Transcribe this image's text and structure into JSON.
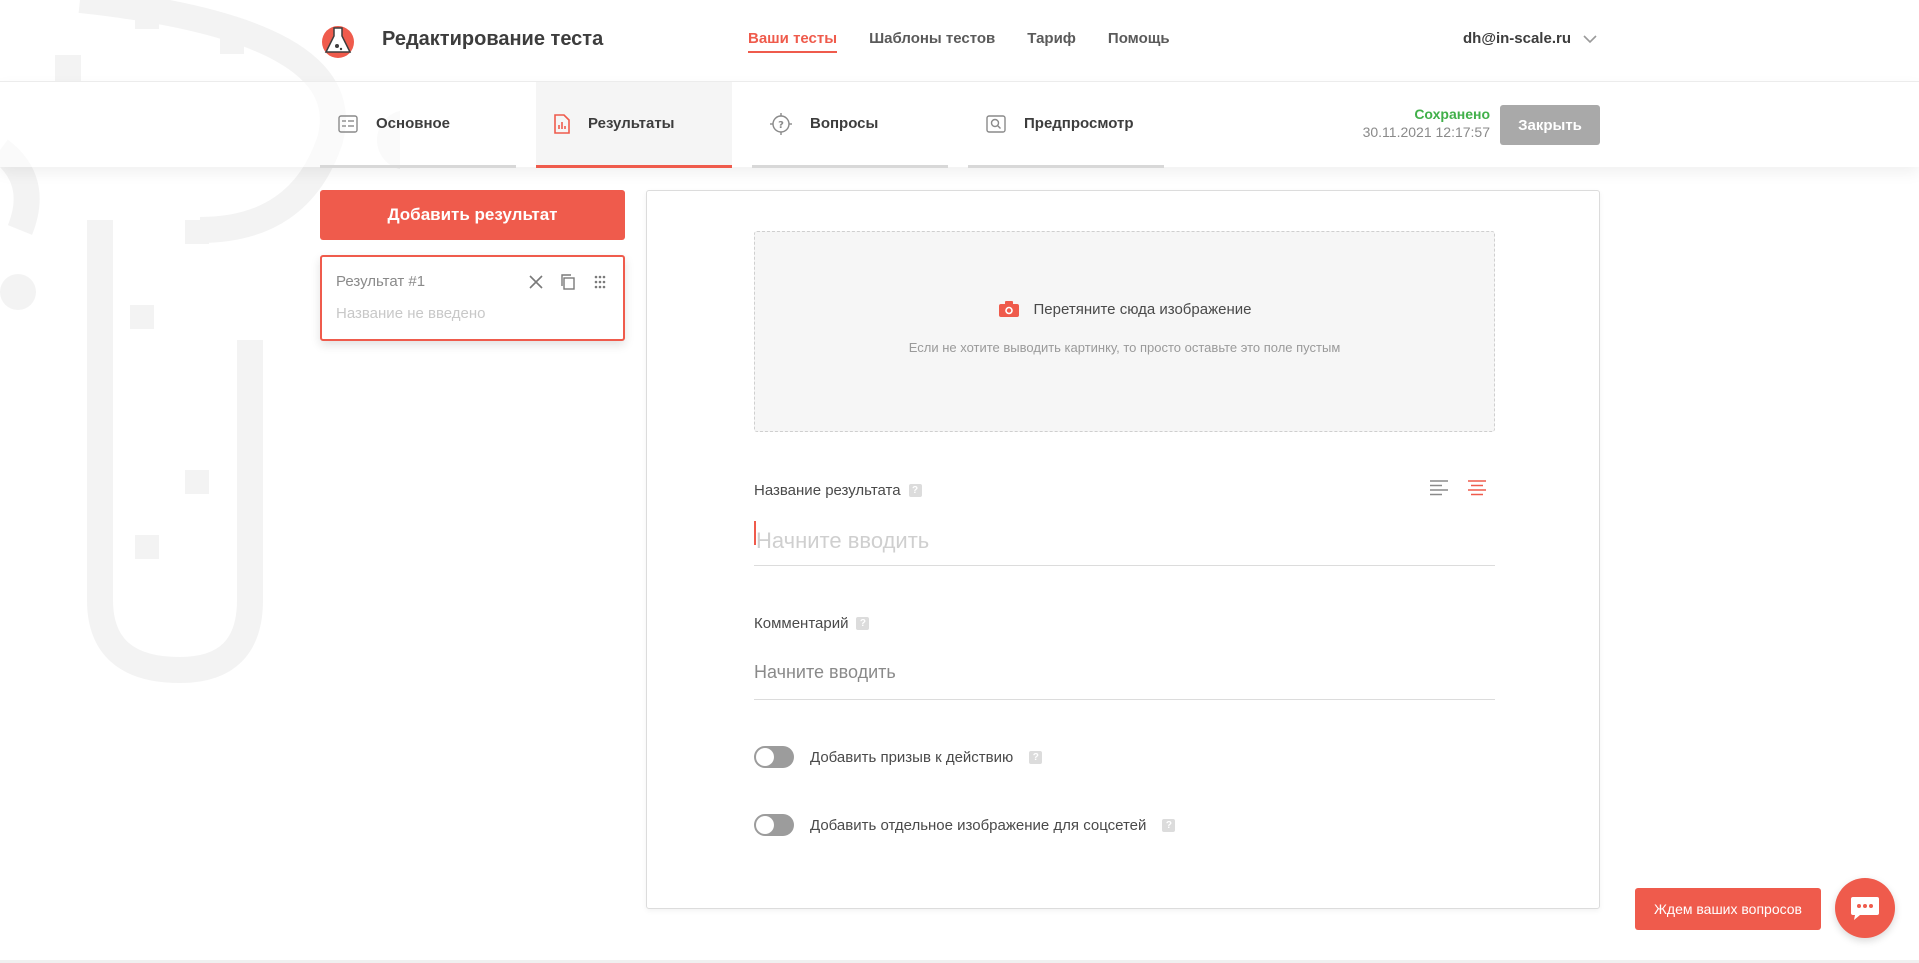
{
  "header": {
    "title": "Редактирование теста",
    "nav": [
      {
        "label": "Ваши тесты",
        "active": true
      },
      {
        "label": "Шаблоны тестов",
        "active": false
      },
      {
        "label": "Тариф",
        "active": false
      },
      {
        "label": "Помощь",
        "active": false
      }
    ],
    "user_email": "dh@in-scale.ru"
  },
  "tabs": [
    {
      "label": "Основное",
      "icon": "form-icon",
      "active": false
    },
    {
      "label": "Результаты",
      "icon": "report-icon",
      "active": true
    },
    {
      "label": "Вопросы",
      "icon": "question-target-icon",
      "active": false
    },
    {
      "label": "Предпросмотр",
      "icon": "preview-icon",
      "active": false
    }
  ],
  "status": {
    "saved_label": "Сохранено",
    "saved_time": "30.11.2021 12:17:57",
    "close_label": "Закрыть"
  },
  "sidebar": {
    "add_label": "Добавить результат",
    "results": [
      {
        "title": "Результат #1",
        "subtitle": "Название не введено"
      }
    ]
  },
  "editor": {
    "dropzone_label": "Перетяните сюда изображение",
    "dropzone_hint": "Если не хотите выводить картинку, то просто оставьте это поле пустым",
    "title_label": "Название результата",
    "title_placeholder": "Начните вводить",
    "comment_label": "Комментарий",
    "comment_placeholder": "Начните вводить",
    "toggle_cta": "Добавить призыв к действию",
    "toggle_social": "Добавить отдельное изображение для соцсетей",
    "help_mark": "?"
  },
  "chat": {
    "label": "Ждем ваших вопросов"
  },
  "colors": {
    "accent": "#ef5b4c",
    "saved": "#41b04a",
    "disabled_button": "#a9a9a9"
  }
}
